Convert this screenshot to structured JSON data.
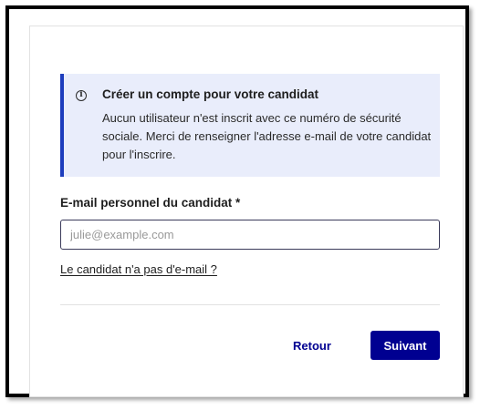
{
  "notice": {
    "icon": "info-icon",
    "title": "Créer un compte pour votre candidat",
    "body": "Aucun utilisateur n'est inscrit avec ce numéro de sécurité sociale. Merci de renseigner l'adresse e-mail de votre candidat pour l'inscrire.",
    "background_color": "#e9edfb",
    "accent_color": "#1d3dbd"
  },
  "form": {
    "email_label": "E-mail personnel du candidat *",
    "email_value": "",
    "email_placeholder": "julie@example.com",
    "no_email_link": "Le candidat n'a pas d'e-mail ?"
  },
  "actions": {
    "back_label": "Retour",
    "next_label": "Suivant",
    "primary_color": "#000091"
  }
}
